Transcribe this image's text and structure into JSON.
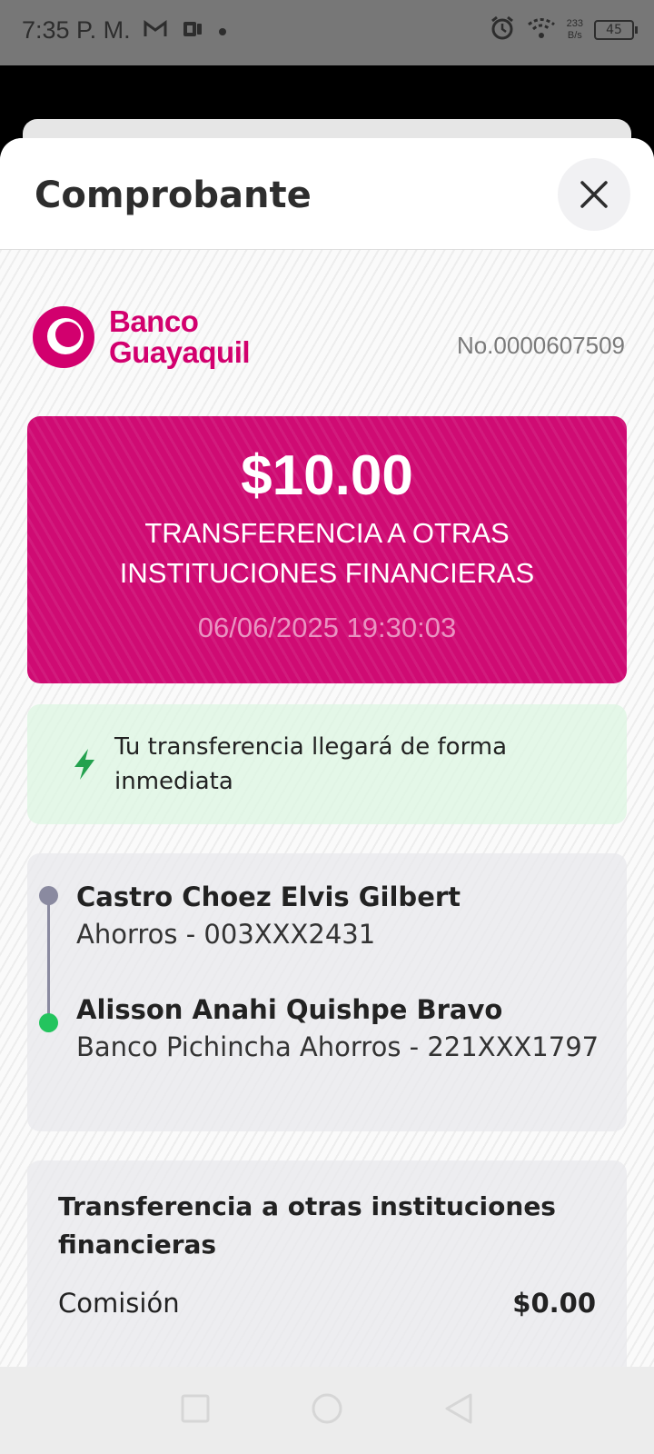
{
  "status_bar": {
    "time": "7:35 P. M.",
    "net_speed_value": "233",
    "net_speed_unit": "B/s",
    "battery": "45"
  },
  "sheet": {
    "title": "Comprobante"
  },
  "receipt": {
    "bank_name_line1": "Banco",
    "bank_name_line2": "Guayaquil",
    "number": "No.0000607509",
    "amount": "$10.00",
    "type_label": "TRANSFERENCIA A OTRAS INSTITUCIONES FINANCIERAS",
    "datetime": "06/06/2025 19:30:03",
    "notice": "Tu transferencia llegará de forma inmediata",
    "from": {
      "name": "Castro Choez Elvis Gilbert",
      "account": "Ahorros - 003XXX2431"
    },
    "to": {
      "name": "Alisson Anahi Quishpe Bravo",
      "account": "Banco Pichincha Ahorros - 221XXX1797"
    },
    "details": {
      "title": "Transferencia a otras instituciones financieras",
      "fee_label": "Comisión",
      "fee_value": "$0.00"
    }
  },
  "colors": {
    "brand": "#d2006e",
    "success": "#23c45e"
  }
}
